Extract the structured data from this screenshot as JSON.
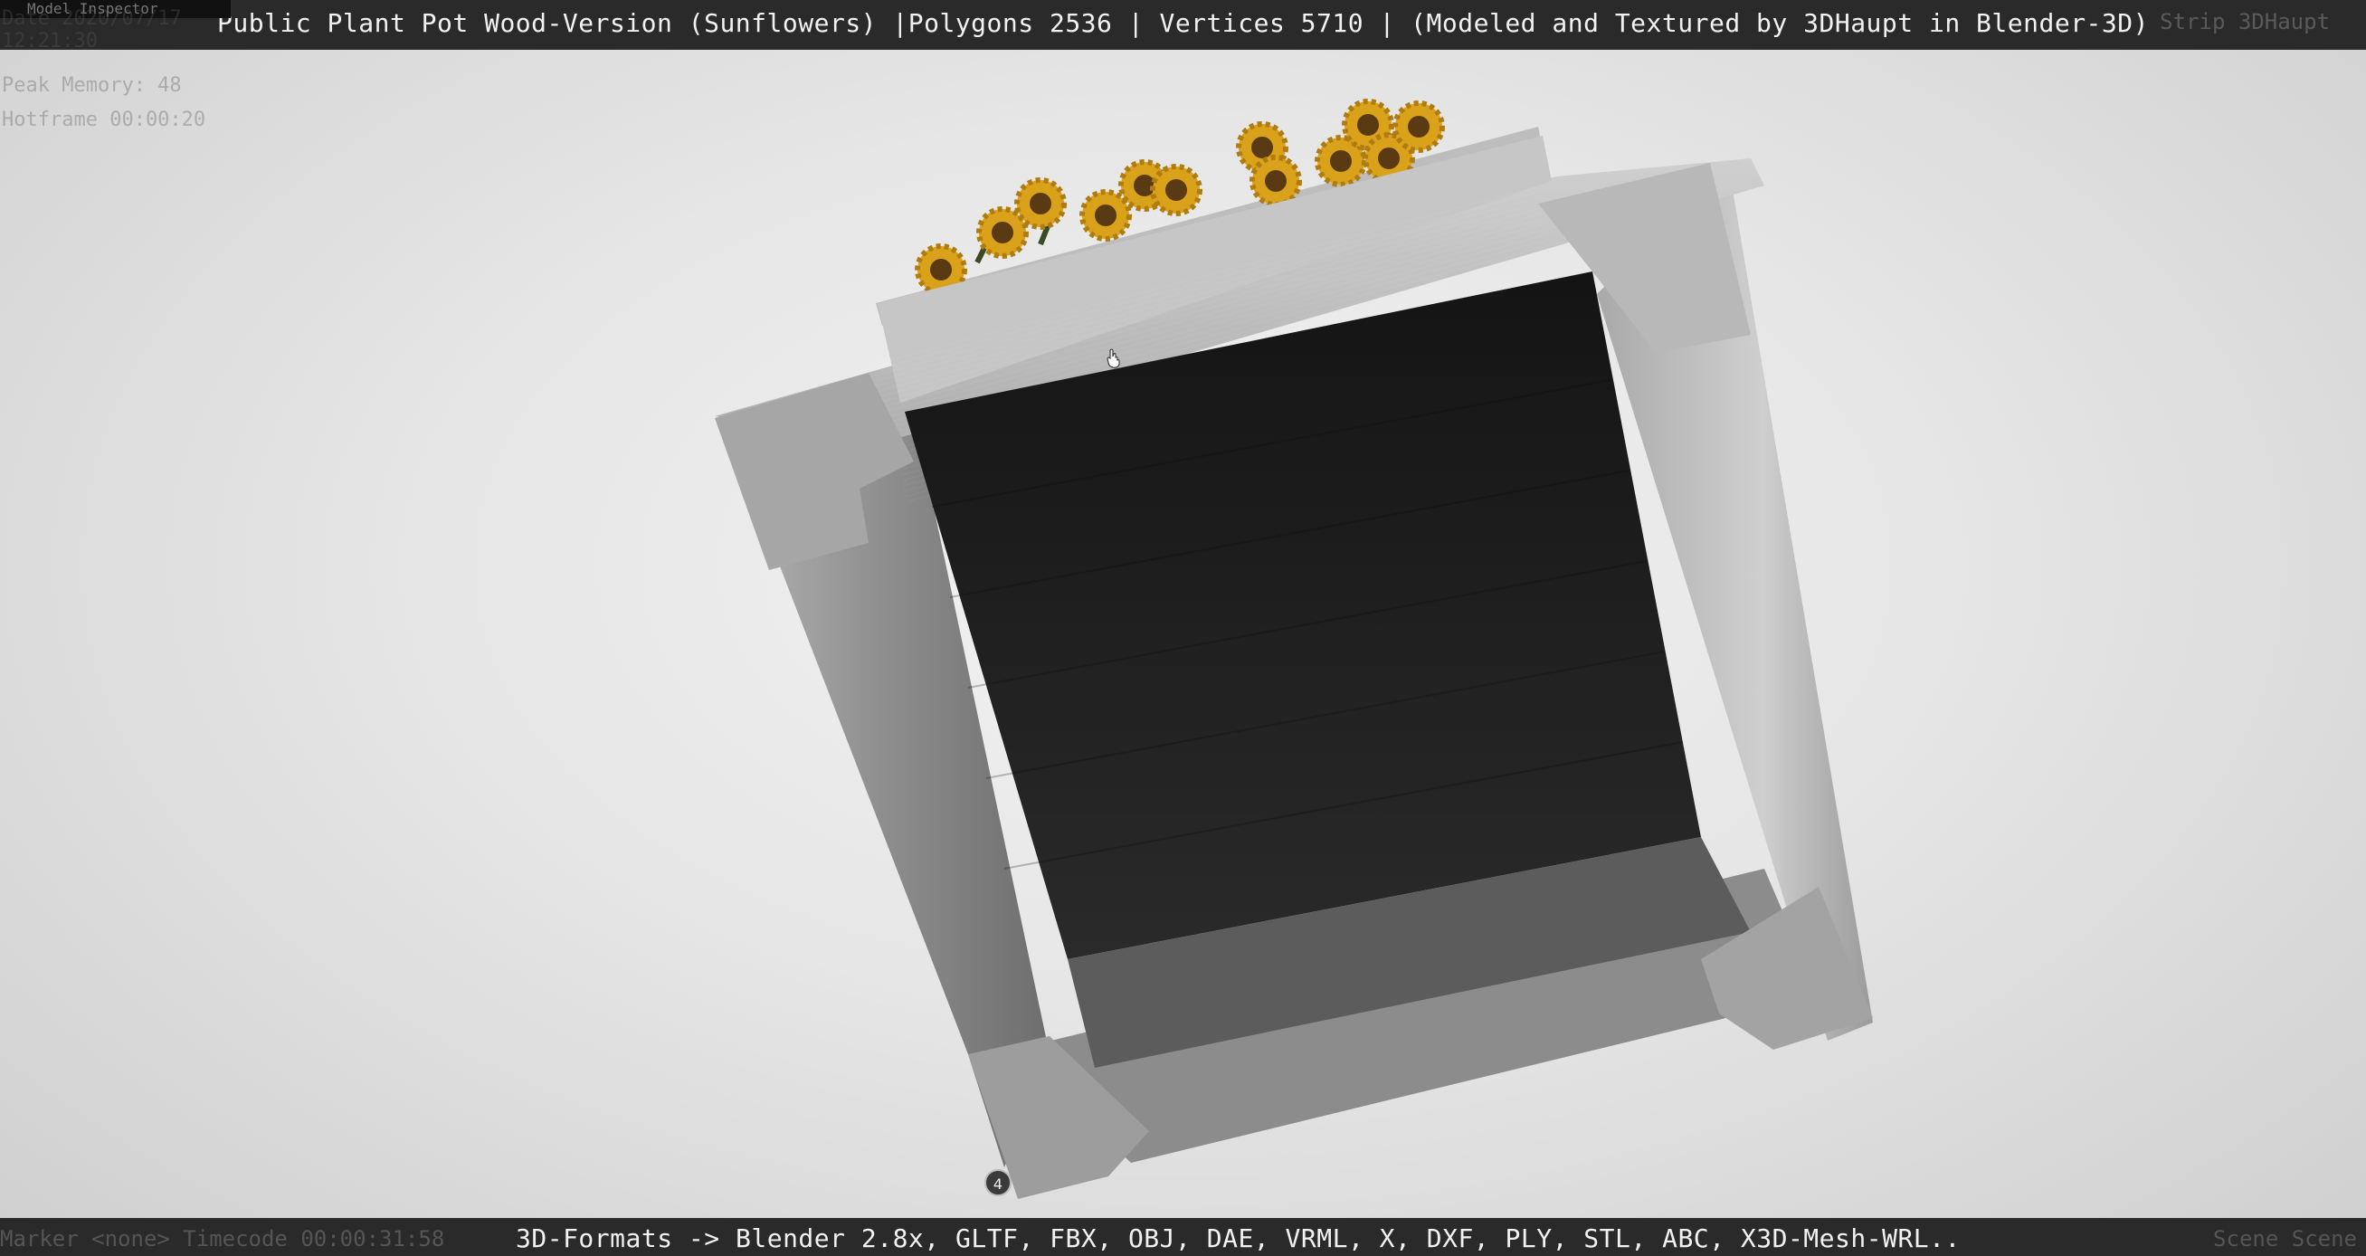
{
  "header": {
    "title": "Public Plant Pot Wood-Version (Sunflowers) |Polygons 2536 | Vertices 5710 | (Modeled and Textured by 3DHaupt in Blender-3D)",
    "ghost_right": "Strip 3DHaupt"
  },
  "overlay_panel": {
    "tag": "Model Inspector",
    "lines": [
      "Date 2020/07/17 12:21:30",
      "Peak Memory: 48",
      "Hotframe 00:00:20"
    ]
  },
  "footer": {
    "formats": "3D-Formats -> Blender 2.8x, GLTF, FBX, OBJ, DAE, VRML, X, DXF, PLY, STL, ABC, X3D-Mesh-WRL..",
    "ghost_left": "Marker <none>   Timecode 00:00:31:58",
    "ghost_right": "Scene Scene"
  },
  "viewport": {
    "marker_label": "4",
    "icons": [
      "cursor-hand-icon",
      "sunflower-icon"
    ],
    "colors": {
      "bar": "#2a2a2a",
      "wood": "#a9a9a9",
      "interior": "#1b1b1b",
      "petal": "#d9a21a",
      "seed": "#5a3a12"
    }
  }
}
